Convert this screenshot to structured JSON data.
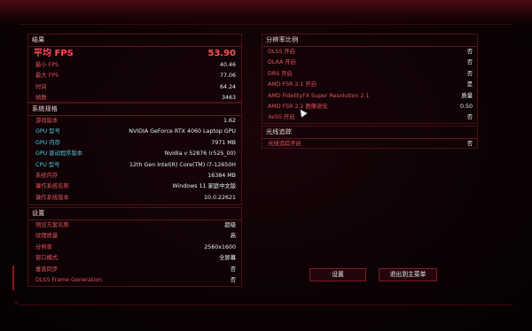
{
  "results": {
    "title": "结果",
    "avg_fps_label": "平均 FPS",
    "avg_fps_value": "53.90",
    "rows": [
      {
        "label": "最小 FPS",
        "value": "40.46"
      },
      {
        "label": "最大 FPS",
        "value": "77.06"
      },
      {
        "label": "时间",
        "value": "64.24"
      },
      {
        "label": "帧数",
        "value": "3463"
      }
    ]
  },
  "system": {
    "title": "系统规格",
    "rows": [
      {
        "label": "游戏版本",
        "value": "1.62"
      },
      {
        "label": "GPU 型号",
        "value": "NVIDIA GeForce RTX 4060 Laptop GPU"
      },
      {
        "label": "GPU 内存",
        "value": "7971 MB"
      },
      {
        "label": "GPU 驱动程序版本",
        "value": "Nvidia v 52876 (r525_00)"
      },
      {
        "label": "CPU 型号",
        "value": "12th Gen Intel(R) Core(TM) i7-12650H"
      },
      {
        "label": "系统内存",
        "value": "16384 MB"
      },
      {
        "label": "操作系统名称",
        "value": "Windows 11 家庭中文版"
      },
      {
        "label": "操作系统版本",
        "value": "10.0.22621"
      }
    ]
  },
  "settings": {
    "title": "设置",
    "rows": [
      {
        "label": "预设方案名称",
        "value": "超级"
      },
      {
        "label": "纹理质量",
        "value": "高"
      },
      {
        "label": "分辨率",
        "value": "2560x1600"
      },
      {
        "label": "窗口模式",
        "value": "全屏幕"
      },
      {
        "label": "垂直同步",
        "value": "否"
      },
      {
        "label": "DLSS Frame Generation",
        "value": "否"
      }
    ]
  },
  "resolution_scaling": {
    "title": "分辨率比例",
    "rows": [
      {
        "label": "DLSS 开启",
        "value": "否"
      },
      {
        "label": "DLAA 开启",
        "value": "否"
      },
      {
        "label": "DRS 开启",
        "value": "否"
      },
      {
        "label": "AMD FSR 2.1 开启",
        "value": "是"
      },
      {
        "label": "AMD FidelityFX Super Resolution 2.1",
        "value": "质量"
      },
      {
        "label": "AMD FSR 2.1 图像锐化",
        "value": "0.50"
      },
      {
        "label": "XeSS 开启",
        "value": "否"
      }
    ]
  },
  "ray_tracing": {
    "title": "光线追踪",
    "rows": [
      {
        "label": "光线追踪开启",
        "value": "否"
      }
    ]
  },
  "buttons": {
    "settings": "设置",
    "exit_main_menu": "退出到主菜单"
  },
  "colors": {
    "accent_red": "#ff4d56",
    "label_red": "#e05560",
    "value_white": "#e6f3f5",
    "border": "#4a1018"
  }
}
